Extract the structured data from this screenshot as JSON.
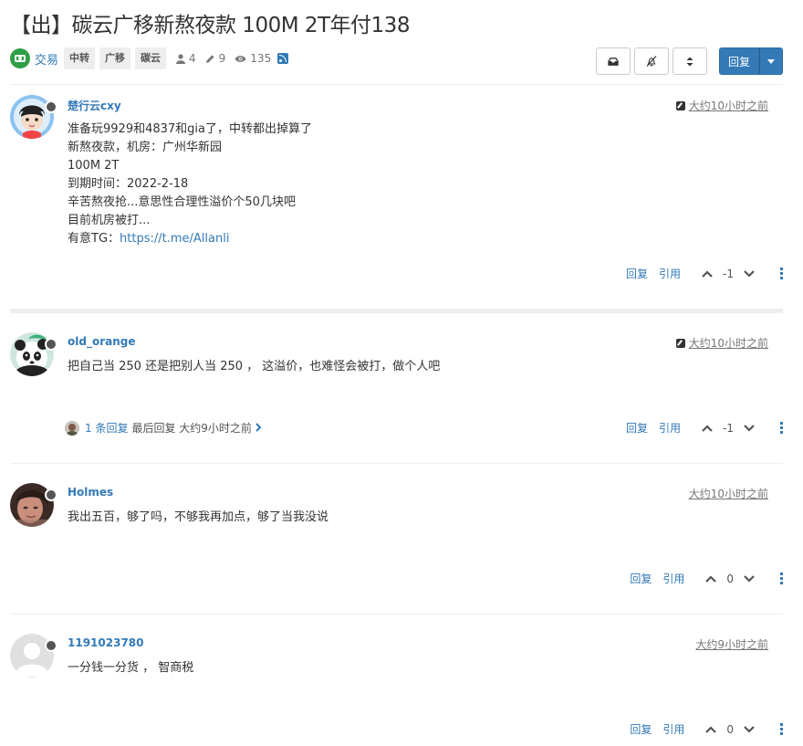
{
  "topic": {
    "title": "【出】碳云广移新熬夜款 100M 2T年付138",
    "category": "交易",
    "tags": [
      "中转",
      "广移",
      "碳云"
    ],
    "posters_count": "4",
    "posts_count": "9",
    "views_count": "135"
  },
  "toolbar": {
    "reply_label": "回复"
  },
  "posts": [
    {
      "username": "楚行云cxy",
      "time": "大约10小时之前",
      "edited": true,
      "lines": [
        "准备玩9929和4837和gia了，中转都出掉算了",
        "新熬夜款，机房：广州华新园",
        "100M 2T",
        "到期时间：2022-2-18",
        "辛苦熬夜抢...意思性合理性溢价个50几块吧",
        "目前机房被打...",
        "有意TG："
      ],
      "link": "https://t.me/Allanli",
      "reply_label": "回复",
      "quote_label": "引用",
      "votes": "-1"
    },
    {
      "username": "old_orange",
      "time": "大约10小时之前",
      "edited": true,
      "lines": [
        "把自己当 250 还是把别人当 250 ， 这溢价，也难怪会被打，做个人吧"
      ],
      "replies_count": "1 条回复",
      "replies_last": "最后回复 大约9小时之前",
      "reply_label": "回复",
      "quote_label": "引用",
      "votes": "-1"
    },
    {
      "username": "Holmes",
      "time": "大约10小时之前",
      "edited": false,
      "lines": [
        "我出五百，够了吗，不够我再加点，够了当我没说"
      ],
      "reply_label": "回复",
      "quote_label": "引用",
      "votes": "0"
    },
    {
      "username": "1191023780",
      "time": "大约9小时之前",
      "edited": false,
      "lines": [
        "一分钱一分货 ， 智商税"
      ],
      "reply_label": "回复",
      "quote_label": "引用",
      "votes": "0"
    }
  ],
  "colors": {
    "link": "#337ab7",
    "category": "#2e9e47",
    "primary_button": "#337ab7"
  }
}
